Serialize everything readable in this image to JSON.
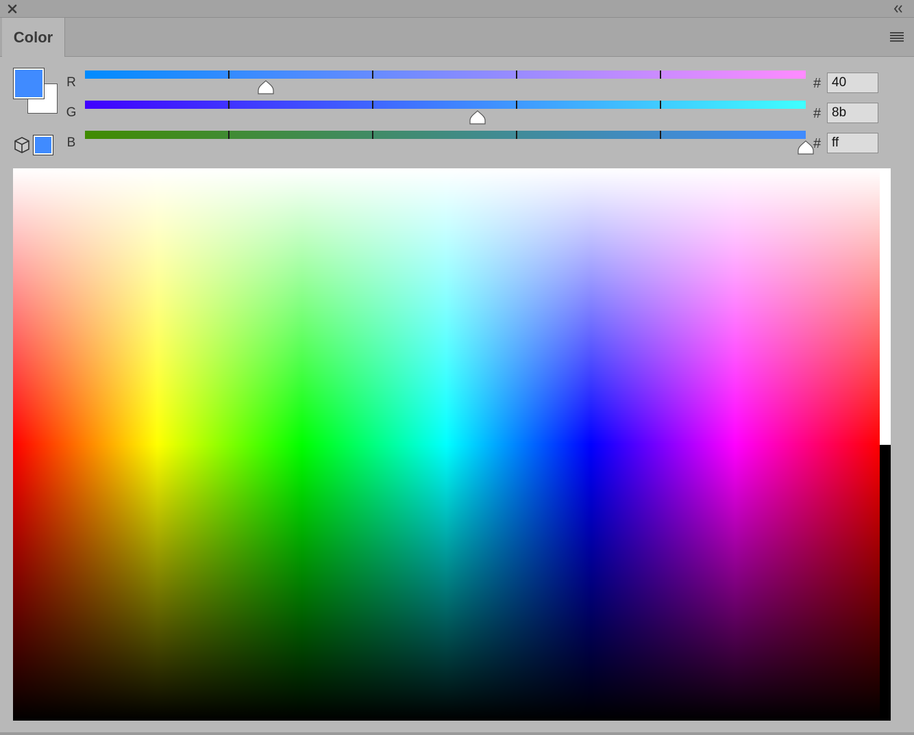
{
  "panel": {
    "tab_label": "Color",
    "icons": {
      "close": "close-icon",
      "collapse": "double-chevron-left-icon",
      "menu": "hamburger-menu-icon",
      "color_cube": "cube-icon"
    }
  },
  "colors": {
    "fill": "#408bff",
    "stroke": "#ffffff",
    "web_safe": "#408bff"
  },
  "channels": [
    {
      "label": "R",
      "hex": "40",
      "value": 64,
      "gradient_start": "#008bff",
      "gradient_end": "#ff8bff"
    },
    {
      "label": "G",
      "hex": "8b",
      "value": 139,
      "gradient_start": "#4000ff",
      "gradient_end": "#40ffff"
    },
    {
      "label": "B",
      "hex": "ff",
      "value": 255,
      "gradient_start": "#408b00",
      "gradient_end": "#408bff"
    }
  ],
  "hash_symbol": "#",
  "spectrum": {
    "hues": [
      "#ff0000",
      "#ffff00",
      "#00ff00",
      "#00ffff",
      "#0000ff",
      "#ff00ff",
      "#ff0000"
    ],
    "white_swatch": "#ffffff",
    "black_swatch": "#000000"
  }
}
